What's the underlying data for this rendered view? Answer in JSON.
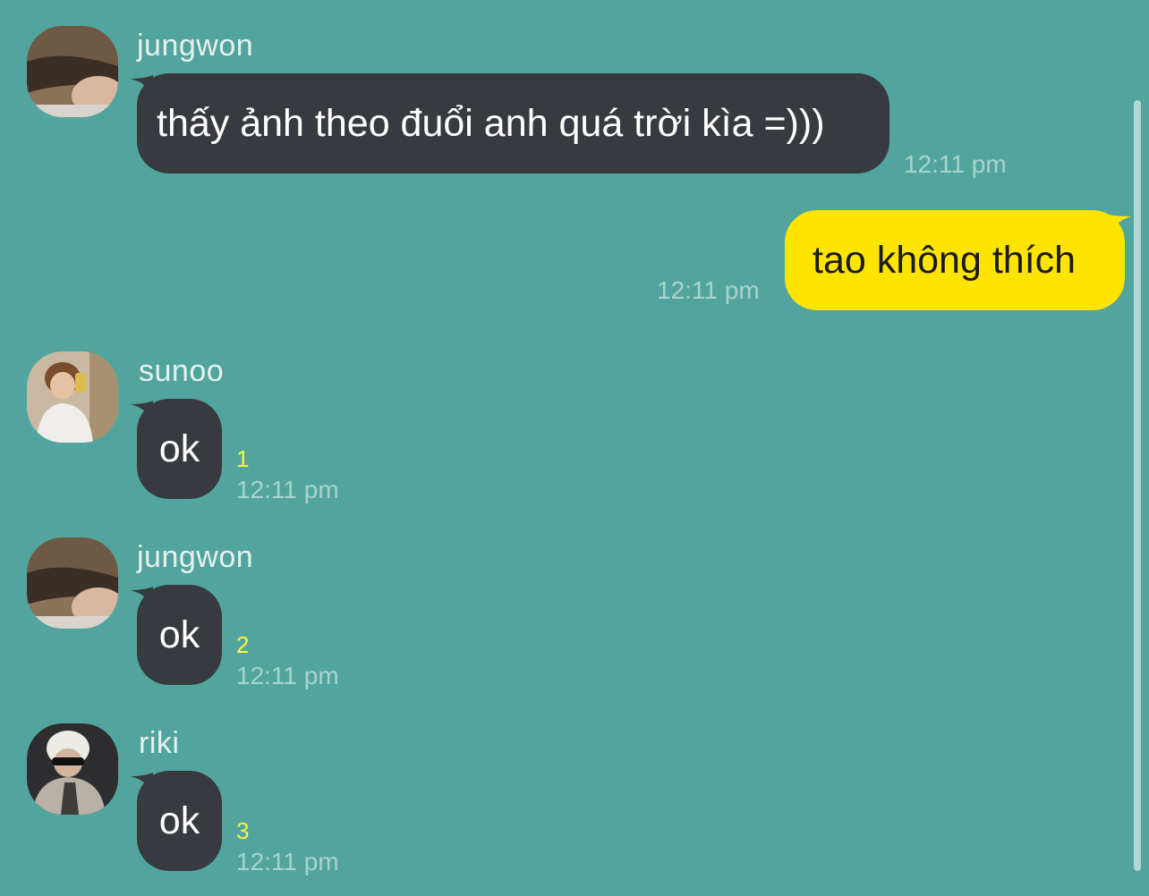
{
  "messages": [
    {
      "sender": "jungwon",
      "text": "thấy ảnh theo đuổi anh quá trời kìa =)))",
      "time": "12:11 pm"
    },
    {
      "text": "tao không thích",
      "time": "12:11 pm"
    },
    {
      "sender": "sunoo",
      "text": "ok",
      "unread": "1",
      "time": "12:11 pm"
    },
    {
      "sender": "jungwon",
      "text": "ok",
      "unread": "2",
      "time": "12:11 pm"
    },
    {
      "sender": "riki",
      "text": "ok",
      "unread": "3",
      "time": "12:11 pm"
    }
  ],
  "colors": {
    "background": "#52a59e",
    "incoming_bubble": "#373a3e",
    "outgoing_bubble": "#fee500",
    "unread_count": "#fef23a"
  }
}
